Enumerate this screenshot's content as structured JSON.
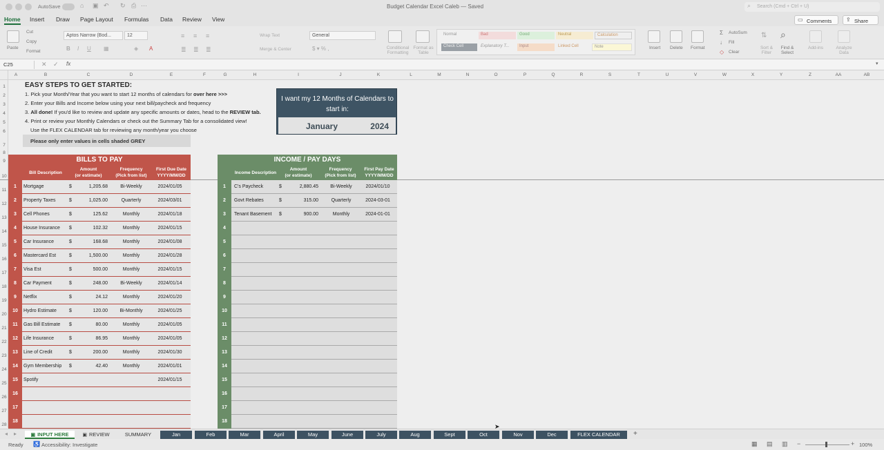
{
  "window": {
    "title": "Budget Calendar Excel Caleb — Saved",
    "autosave_label": "AutoSave",
    "autosave_state": "off",
    "search_placeholder": "Search (Cmd + Ctrl + U)"
  },
  "ribbon_tabs": [
    "Home",
    "Insert",
    "Draw",
    "Page Layout",
    "Formulas",
    "Data",
    "Review",
    "View"
  ],
  "ribbon": {
    "paste": "Paste",
    "cut": "Cut",
    "copy": "Copy",
    "format": "Format",
    "font_name": "Aptos Narrow (Bod...",
    "font_size": "12",
    "wrap_text": "Wrap Text",
    "merge_center": "Merge & Center",
    "number_format": "General",
    "conditional_formatting": "Conditional Formatting",
    "format_as_table": "Format as Table",
    "styles": [
      "Normal",
      "Bad",
      "Good",
      "Neutral",
      "Calculation",
      "Check Cell",
      "Explanatory T...",
      "Input",
      "Linked Cell",
      "Note"
    ],
    "insert": "Insert",
    "delete": "Delete",
    "format_cells": "Format",
    "autosum": "AutoSum",
    "fill": "Fill",
    "clear": "Clear",
    "sort_filter": "Sort & Filter",
    "find_select": "Find & Select",
    "addins": "Add-ins",
    "analyze": "Analyze Data",
    "comments": "Comments",
    "share": "Share"
  },
  "formula_bar": {
    "cell_ref": "C25",
    "fx": "fx",
    "value": ""
  },
  "columns": [
    "A",
    "B",
    "C",
    "D",
    "E",
    "F",
    "G",
    "H",
    "I",
    "J",
    "K",
    "L",
    "M",
    "N",
    "O",
    "P",
    "Q",
    "R",
    "S",
    "T",
    "U",
    "V",
    "W",
    "X",
    "Y",
    "Z",
    "AA",
    "AB"
  ],
  "rows": [
    "1",
    "2",
    "3",
    "4",
    "5",
    "6",
    "7",
    "8",
    "9",
    "10",
    "11",
    "12",
    "13",
    "14",
    "15",
    "16",
    "17",
    "18",
    "19",
    "20",
    "21",
    "22",
    "23",
    "24",
    "25",
    "26",
    "27",
    "28"
  ],
  "instructions": {
    "title": "EASY STEPS TO GET STARTED:",
    "step1_pre": "1.  Pick your Month/Year that you want to start 12 months of calendars for ",
    "step1_bold": "over here  >>>",
    "step2": "2.  Enter your Bills and Income below using your next bill/paycheck and frequency",
    "step3_num": "3. ",
    "step3_bold1": "All done!",
    "step3_mid": "  If you'd like to review and update any specific amounts or dates, head to the ",
    "step3_bold2": "REVIEW tab.",
    "step4": "4.  Print or review your Monthly Calendars or check out the Summary Tab for a consolidated view!",
    "step5": "Use the FLEX CALENDAR tab for reviewing any month/year you choose",
    "grey_note": "Please only enter values in cells shaded GREY"
  },
  "start_box": {
    "label": "I want my 12 Months of Calendars to start in:",
    "month": "January",
    "year": "2024"
  },
  "bills": {
    "title": "BILLS TO PAY",
    "headers": {
      "description": "Bill Description",
      "amount": "Amount\n(or estimate)",
      "frequency": "Frequency\n(Pick from list)",
      "first_due": "First Due Date\nYYYY/MM/DD"
    },
    "rows": [
      {
        "n": "1",
        "desc": "Mortgage",
        "cur": "$",
        "amount": "1,205.68",
        "freq": "Bi-Weekly",
        "date": "2024/01/05"
      },
      {
        "n": "2",
        "desc": "Property Taxes",
        "cur": "$",
        "amount": "1,025.00",
        "freq": "Quarterly",
        "date": "2024/03/01"
      },
      {
        "n": "3",
        "desc": "Cell Phones",
        "cur": "$",
        "amount": "125.62",
        "freq": "Monthly",
        "date": "2024/01/18"
      },
      {
        "n": "4",
        "desc": "House Insurance",
        "cur": "$",
        "amount": "102.32",
        "freq": "Monthly",
        "date": "2024/01/15"
      },
      {
        "n": "5",
        "desc": "Car Insurance",
        "cur": "$",
        "amount": "168.68",
        "freq": "Monthly",
        "date": "2024/01/08"
      },
      {
        "n": "6",
        "desc": "Mastercard Est",
        "cur": "$",
        "amount": "1,500.00",
        "freq": "Monthly",
        "date": "2024/01/28"
      },
      {
        "n": "7",
        "desc": "Visa Est",
        "cur": "$",
        "amount": "500.00",
        "freq": "Monthly",
        "date": "2024/01/15"
      },
      {
        "n": "8",
        "desc": "Car Payment",
        "cur": "$",
        "amount": "248.00",
        "freq": "Bi-Weekly",
        "date": "2024/01/14"
      },
      {
        "n": "9",
        "desc": "Netflix",
        "cur": "$",
        "amount": "24.12",
        "freq": "Monthly",
        "date": "2024/01/20"
      },
      {
        "n": "10",
        "desc": "Hydro Estimate",
        "cur": "$",
        "amount": "120.00",
        "freq": "Bi-Monthly",
        "date": "2024/01/25"
      },
      {
        "n": "11",
        "desc": "Gas Bill Estimate",
        "cur": "$",
        "amount": "80.00",
        "freq": "Monthly",
        "date": "2024/01/05"
      },
      {
        "n": "12",
        "desc": "Life Insurance",
        "cur": "$",
        "amount": "86.95",
        "freq": "Monthly",
        "date": "2024/01/05"
      },
      {
        "n": "13",
        "desc": "Line of Credit",
        "cur": "$",
        "amount": "200.00",
        "freq": "Monthly",
        "date": "2024/01/30"
      },
      {
        "n": "14",
        "desc": "Gym Membership",
        "cur": "$",
        "amount": "42.40",
        "freq": "Monthly",
        "date": "2024/01/01"
      },
      {
        "n": "15",
        "desc": "Spotify",
        "cur": "",
        "amount": "",
        "freq": "",
        "date": "2024/01/15"
      },
      {
        "n": "16",
        "desc": "",
        "cur": "",
        "amount": "",
        "freq": "",
        "date": ""
      },
      {
        "n": "17",
        "desc": "",
        "cur": "",
        "amount": "",
        "freq": "",
        "date": ""
      },
      {
        "n": "18",
        "desc": "",
        "cur": "",
        "amount": "",
        "freq": "",
        "date": ""
      }
    ]
  },
  "income": {
    "title": "INCOME / PAY DAYS",
    "headers": {
      "description": "Income Description",
      "amount": "Amount\n(or estimate)",
      "frequency": "Frequency\n(Pick from list)",
      "first_pay": "First Pay Date\nYYYY/MM/DD"
    },
    "rows": [
      {
        "n": "1",
        "desc": "C's Paycheck",
        "cur": "$",
        "amount": "2,880.45",
        "freq": "Bi-Weekly",
        "date": "2024/01/10"
      },
      {
        "n": "2",
        "desc": "Govt Rebates",
        "cur": "$",
        "amount": "315.00",
        "freq": "Quarterly",
        "date": "2024-03-01"
      },
      {
        "n": "3",
        "desc": "Tenant Basement",
        "cur": "$",
        "amount": "900.00",
        "freq": "Monthly",
        "date": "2024-01-01"
      },
      {
        "n": "4",
        "desc": "",
        "cur": "",
        "amount": "",
        "freq": "",
        "date": ""
      },
      {
        "n": "5",
        "desc": "",
        "cur": "",
        "amount": "",
        "freq": "",
        "date": ""
      },
      {
        "n": "6",
        "desc": "",
        "cur": "",
        "amount": "",
        "freq": "",
        "date": ""
      },
      {
        "n": "7",
        "desc": "",
        "cur": "",
        "amount": "",
        "freq": "",
        "date": ""
      },
      {
        "n": "8",
        "desc": "",
        "cur": "",
        "amount": "",
        "freq": "",
        "date": ""
      },
      {
        "n": "9",
        "desc": "",
        "cur": "",
        "amount": "",
        "freq": "",
        "date": ""
      },
      {
        "n": "10",
        "desc": "",
        "cur": "",
        "amount": "",
        "freq": "",
        "date": ""
      },
      {
        "n": "11",
        "desc": "",
        "cur": "",
        "amount": "",
        "freq": "",
        "date": ""
      },
      {
        "n": "12",
        "desc": "",
        "cur": "",
        "amount": "",
        "freq": "",
        "date": ""
      },
      {
        "n": "13",
        "desc": "",
        "cur": "",
        "amount": "",
        "freq": "",
        "date": ""
      },
      {
        "n": "14",
        "desc": "",
        "cur": "",
        "amount": "",
        "freq": "",
        "date": ""
      },
      {
        "n": "15",
        "desc": "",
        "cur": "",
        "amount": "",
        "freq": "",
        "date": ""
      },
      {
        "n": "16",
        "desc": "",
        "cur": "",
        "amount": "",
        "freq": "",
        "date": ""
      },
      {
        "n": "17",
        "desc": "",
        "cur": "",
        "amount": "",
        "freq": "",
        "date": ""
      },
      {
        "n": "18",
        "desc": "",
        "cur": "",
        "amount": "",
        "freq": "",
        "date": ""
      }
    ]
  },
  "sheet_tabs": [
    {
      "label": "INPUT HERE",
      "kind": "active",
      "locked": true
    },
    {
      "label": "REVIEW",
      "kind": "plain",
      "locked": true
    },
    {
      "label": "SUMMARY",
      "kind": "plain",
      "locked": false
    },
    {
      "label": "Jan",
      "kind": "month"
    },
    {
      "label": "Feb",
      "kind": "month"
    },
    {
      "label": "Mar",
      "kind": "month"
    },
    {
      "label": "April",
      "kind": "month"
    },
    {
      "label": "May",
      "kind": "month"
    },
    {
      "label": "June",
      "kind": "month"
    },
    {
      "label": "July",
      "kind": "month"
    },
    {
      "label": "Aug",
      "kind": "month"
    },
    {
      "label": "Sept",
      "kind": "month"
    },
    {
      "label": "Oct",
      "kind": "month"
    },
    {
      "label": "Nov",
      "kind": "month"
    },
    {
      "label": "Dec",
      "kind": "month"
    },
    {
      "label": "FLEX CALENDAR",
      "kind": "month"
    }
  ],
  "status": {
    "ready": "Ready",
    "accessibility": "Accessibility: Investigate",
    "zoom": "100%"
  },
  "colors": {
    "bills_header": "#c0554a",
    "income_header": "#6b8d68",
    "start_box": "#3e5464",
    "month_tab": "#3d5262",
    "accent": "#1e6f3b"
  }
}
